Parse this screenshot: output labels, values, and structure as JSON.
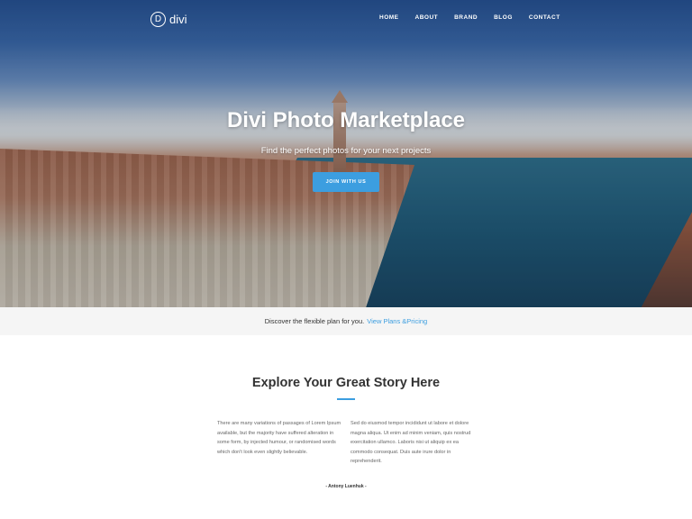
{
  "brand": {
    "logo_letter": "D",
    "name": "divi"
  },
  "nav": {
    "items": [
      {
        "label": "HOME"
      },
      {
        "label": "ABOUT"
      },
      {
        "label": "BRAND"
      },
      {
        "label": "BLOG"
      },
      {
        "label": "CONTACT"
      }
    ]
  },
  "hero": {
    "title": "Divi Photo Marketplace",
    "subtitle": "Find the perfect photos for your next projects",
    "button_label": "JOIN WITH US"
  },
  "plan_bar": {
    "text": "Discover the flexible plan for you.",
    "link_label": "View Plans &Pricing"
  },
  "story": {
    "title": "Explore Your Great Story Here",
    "col_left": "There are many variations of passages of Lorem Ipsum available, but the majority have suffered alteration in some form, by injected humour, or randomised words which don't look even slightly believable.",
    "col_right": "Sed do eiusmod tempor incididunt ut labore et dolore magna aliqua. Ut enim ad minim veniam, quis nostrud exercitation ullamco. Laboris nisi ut aliquip ex ea commodo consequat. Duis aute irure dolor in reprehenderit.",
    "author": "- Antony Luenhuk -"
  },
  "colors": {
    "accent": "#3c9ee0",
    "plan_bar_bg": "#f5f5f5",
    "text_dark": "#333333",
    "text_muted": "#666666"
  }
}
